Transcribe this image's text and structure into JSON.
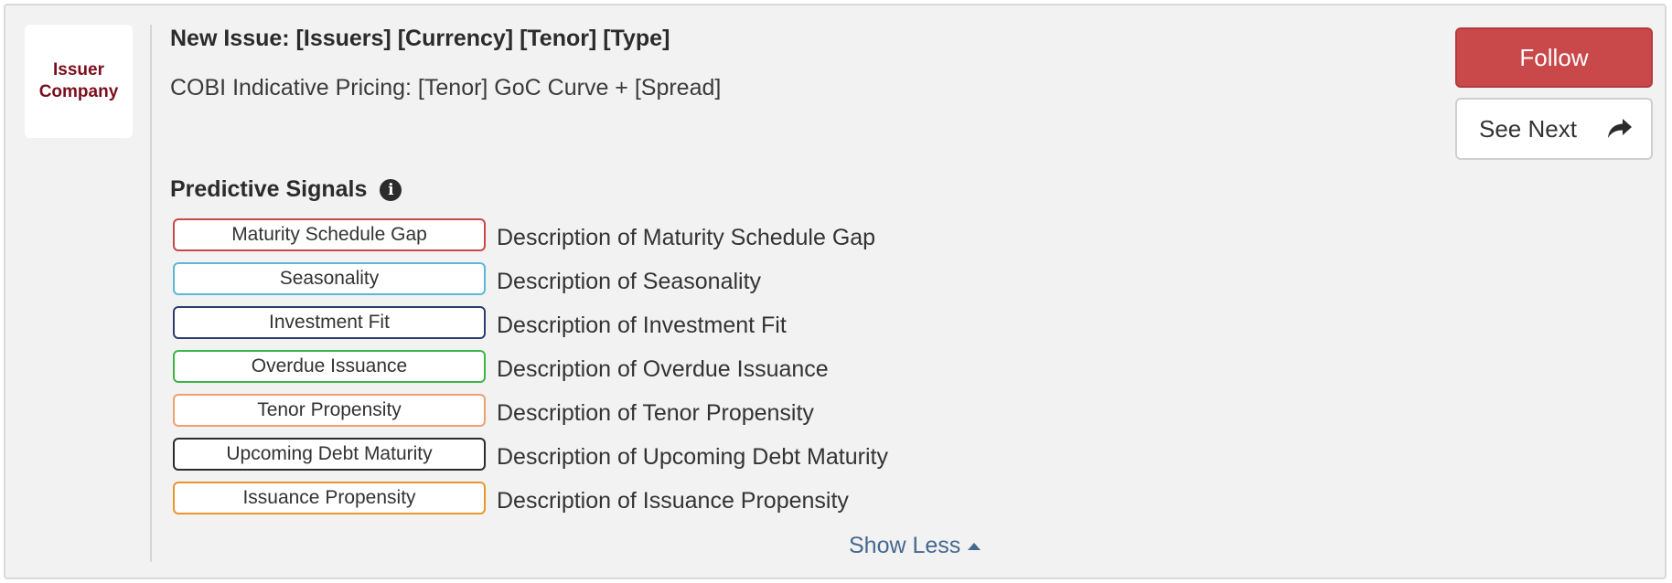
{
  "logo": {
    "text": "Issuer Company"
  },
  "issue": {
    "title": "New Issue: [Issuers] [Currency] [Tenor] [Type]",
    "subtitle": "COBI Indicative Pricing: [Tenor] GoC Curve + [Spread]"
  },
  "actions": {
    "follow_label": "Follow",
    "see_next_label": "See Next"
  },
  "signals": {
    "heading": "Predictive Signals",
    "items": [
      {
        "label": "Maturity Schedule Gap",
        "description": "Description of Maturity Schedule Gap",
        "color": "#c9484a"
      },
      {
        "label": "Seasonality",
        "description": "Description of Seasonality",
        "color": "#5bb8d4"
      },
      {
        "label": "Investment Fit",
        "description": "Description of Investment Fit",
        "color": "#2c3e6b"
      },
      {
        "label": "Overdue Issuance",
        "description": "Description of Overdue Issuance",
        "color": "#3cb54a"
      },
      {
        "label": "Tenor Propensity",
        "description": "Description of Tenor Propensity",
        "color": "#f0a070"
      },
      {
        "label": "Upcoming Debt Maturity",
        "description": "Description of Upcoming Debt Maturity",
        "color": "#2b2b2b"
      },
      {
        "label": "Issuance Propensity",
        "description": "Description of Issuance Propensity",
        "color": "#e8962e"
      }
    ]
  },
  "footer": {
    "show_less_label": "Show Less"
  }
}
